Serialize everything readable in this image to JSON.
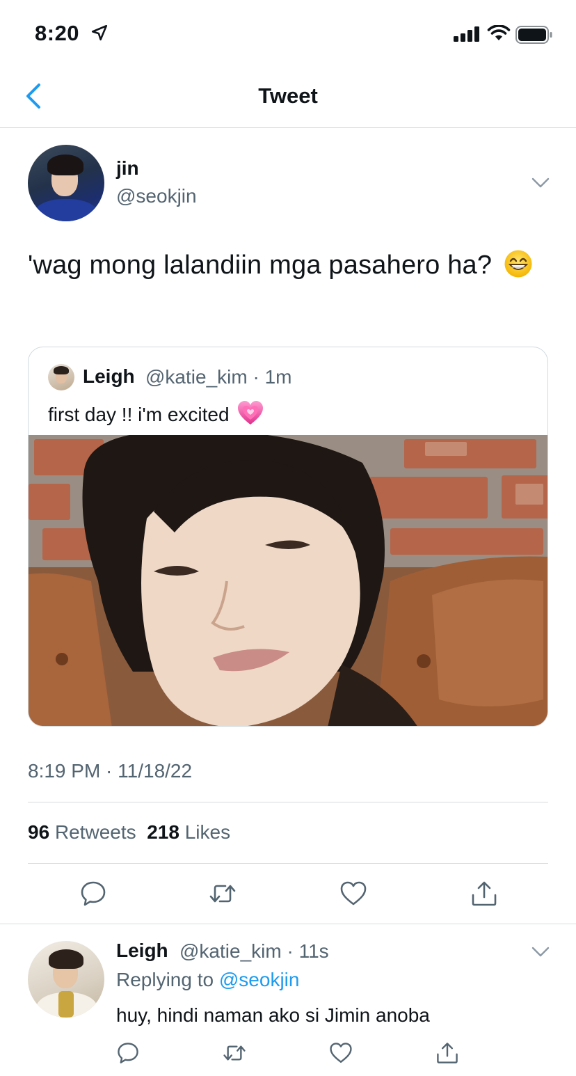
{
  "status_bar": {
    "time": "8:20",
    "icons": [
      "location-arrow-icon",
      "signal-icon",
      "wifi-icon",
      "battery-icon"
    ]
  },
  "nav": {
    "title": "Tweet",
    "back_icon": "chevron-left-icon"
  },
  "tweet": {
    "author_name": "jin",
    "author_handle": "@seokjin",
    "text": "'wag mong lalandiin mga pasahero ha?",
    "emoji": "grinning-face-icon",
    "timestamp": "8:19 PM · 11/18/22",
    "retweets_count": "96",
    "retweets_label": "Retweets",
    "likes_count": "218",
    "likes_label": "Likes",
    "quote": {
      "author_name": "Leigh",
      "author_handle": "@katie_kim · 1m",
      "text": "first day !! i'm excited",
      "emoji": "growing-heart-icon"
    }
  },
  "reply": {
    "author_name": "Leigh",
    "author_handle": "@katie_kim · 11s",
    "replying_prefix": "Replying to",
    "replying_handle": "@seokjin",
    "text": "huy, hindi naman ako si Jimin anoba"
  },
  "colors": {
    "accent": "#1d9bf0",
    "text": "#0f1419",
    "secondary_text": "#536471",
    "divider": "#d6dbdf",
    "icon_gray": "#536471"
  }
}
